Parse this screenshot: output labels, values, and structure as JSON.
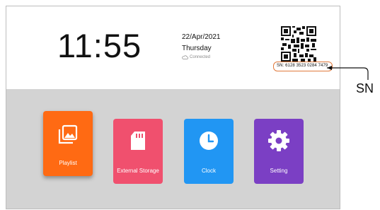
{
  "header": {
    "time": "11:55",
    "date": "22/Apr/2021",
    "weekday": "Thursday",
    "connection_status": "Connected",
    "connection_icon": "cloud-icon",
    "serial_number": "SN: 6128 3523 0284 7479"
  },
  "apps": [
    {
      "label": "Playlist",
      "icon": "photos-icon",
      "color": "#ff6a13"
    },
    {
      "label": "External Storage",
      "icon": "sd-card-icon",
      "color": "#f0506e"
    },
    {
      "label": "Clock",
      "icon": "clock-icon",
      "color": "#2196f3"
    },
    {
      "label": "Setting",
      "icon": "gear-icon",
      "color": "#7b3fc4"
    }
  ],
  "annotation": {
    "callout_label": "SN",
    "highlight_color": "#e0793c"
  }
}
